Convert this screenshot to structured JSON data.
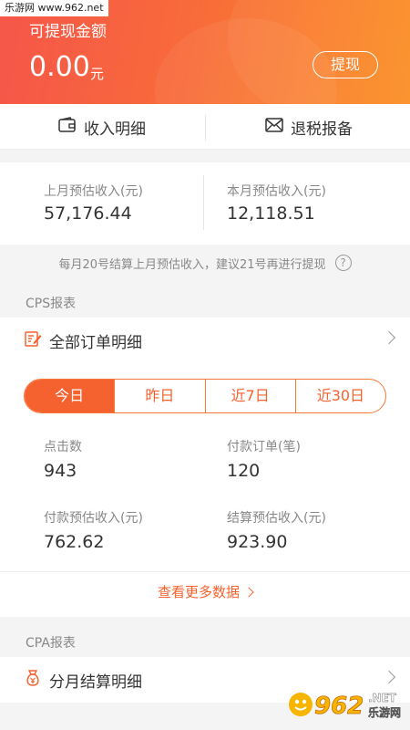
{
  "watermark": "乐游网 www.962.net",
  "header": {
    "withdrawable_label": "可提现金额",
    "amount": "0.00",
    "unit": "元",
    "withdraw_button": "提现"
  },
  "tabs": {
    "income_detail": "收入明细",
    "tax_report": "退税报备"
  },
  "estimates": {
    "last_month_label": "上月预估收入(元)",
    "last_month_value": "57,176.44",
    "this_month_label": "本月预估收入(元)",
    "this_month_value": "12,118.51"
  },
  "notice": {
    "text": "每月20号结算上月预估收入，建议21号再进行提现",
    "help_icon": "?"
  },
  "cps": {
    "section_title": "CPS报表",
    "all_orders": "全部订单明细",
    "periods": [
      "今日",
      "昨日",
      "近7日",
      "近30日"
    ],
    "active_period": "今日",
    "stats": [
      {
        "label": "点击数",
        "value": "943"
      },
      {
        "label": "付款订单(笔)",
        "value": "120"
      },
      {
        "label": "付款预估收入(元)",
        "value": "762.62"
      },
      {
        "label": "结算预估收入(元)",
        "value": "923.90"
      }
    ],
    "more_link": "查看更多数据"
  },
  "cpa": {
    "section_title": "CPA报表",
    "monthly_settlement": "分月结算明细"
  },
  "logo": {
    "text": "962",
    "domain": ".NET",
    "site": "乐游网"
  },
  "colors": {
    "accent": "#f5622f",
    "header_start": "#f5564a",
    "header_end": "#fb8f24"
  }
}
